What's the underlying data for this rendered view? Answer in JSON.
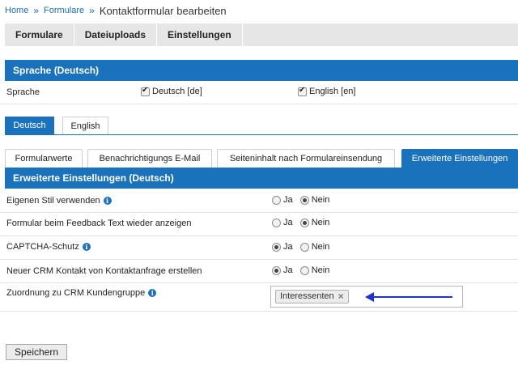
{
  "breadcrumb": {
    "home": "Home",
    "forms": "Formulare",
    "current": "Kontaktformular bearbeiten",
    "separator": "»"
  },
  "topnav": {
    "tabs": [
      "Formulare",
      "Dateiuploads",
      "Einstellungen"
    ]
  },
  "language_section": {
    "title": "Sprache (Deutsch)",
    "label": "Sprache",
    "options": [
      {
        "label": "Deutsch [de]",
        "checked": true
      },
      {
        "label": "English [en]",
        "checked": true
      }
    ]
  },
  "lang_tabs": [
    "Deutsch",
    "English"
  ],
  "section_tabs": [
    "Formularwerte",
    "Benachrichtigungs E-Mail",
    "Seiteninhalt nach Formulareinsendung",
    "Erweiterte Einstellungen"
  ],
  "advanced": {
    "title": "Erweiterte Einstellungen (Deutsch)",
    "yes_label": "Ja",
    "no_label": "Nein",
    "rows": [
      {
        "label": "Eigenen Stil verwenden",
        "info": true,
        "selected": "no"
      },
      {
        "label": "Formular beim Feedback Text wieder anzeigen",
        "info": false,
        "selected": "no"
      },
      {
        "label": "CAPTCHA-Schutz",
        "info": true,
        "selected": "yes"
      },
      {
        "label": "Neuer CRM Kontakt von Kontaktanfrage erstellen",
        "info": false,
        "selected": "yes"
      }
    ],
    "crm_group": {
      "label": "Zuordnung zu CRM Kundengruppe",
      "tag": "Interessenten",
      "remove_symbol": "×"
    }
  },
  "save_button": "Speichern",
  "colors": {
    "accent": "#1a72bd",
    "arrow": "#1f35c8",
    "nav_bg": "#e6e6e6"
  },
  "icons": {
    "info": "info-icon",
    "arrow": "arrow-left-icon"
  }
}
